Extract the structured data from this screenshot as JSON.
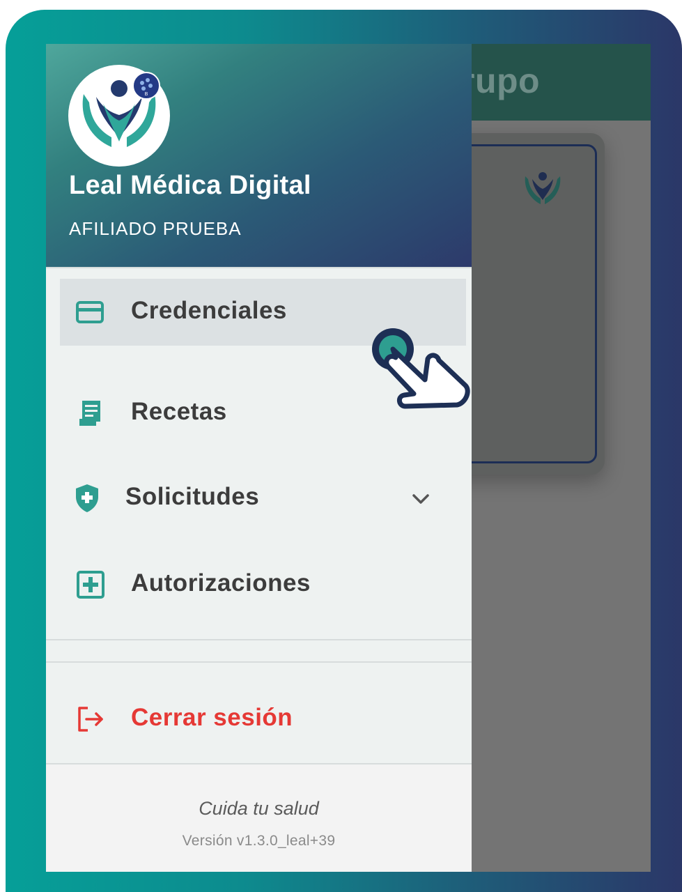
{
  "background": {
    "title_fragment": "rupo"
  },
  "drawer": {
    "app_name": "Leal Médica Digital",
    "user_name": "AFILIADO PRUEBA",
    "items": [
      {
        "label": "Credenciales",
        "icon": "credit-card-icon",
        "active": true
      },
      {
        "label": "Recetas",
        "icon": "receipt-icon",
        "active": false
      },
      {
        "label": "Solicitudes",
        "icon": "shield-plus-icon",
        "active": false,
        "expandable": true
      },
      {
        "label": "Autorizaciones",
        "icon": "plus-box-icon",
        "active": false
      }
    ],
    "logout_label": "Cerrar sesión",
    "footer": {
      "tagline": "Cuida tu salud",
      "version": "Versión v1.3.0_leal+39"
    }
  },
  "colors": {
    "accent_teal": "#2e9e90",
    "logout_red": "#e53935",
    "header_dark_blue": "#2d3a6b"
  }
}
